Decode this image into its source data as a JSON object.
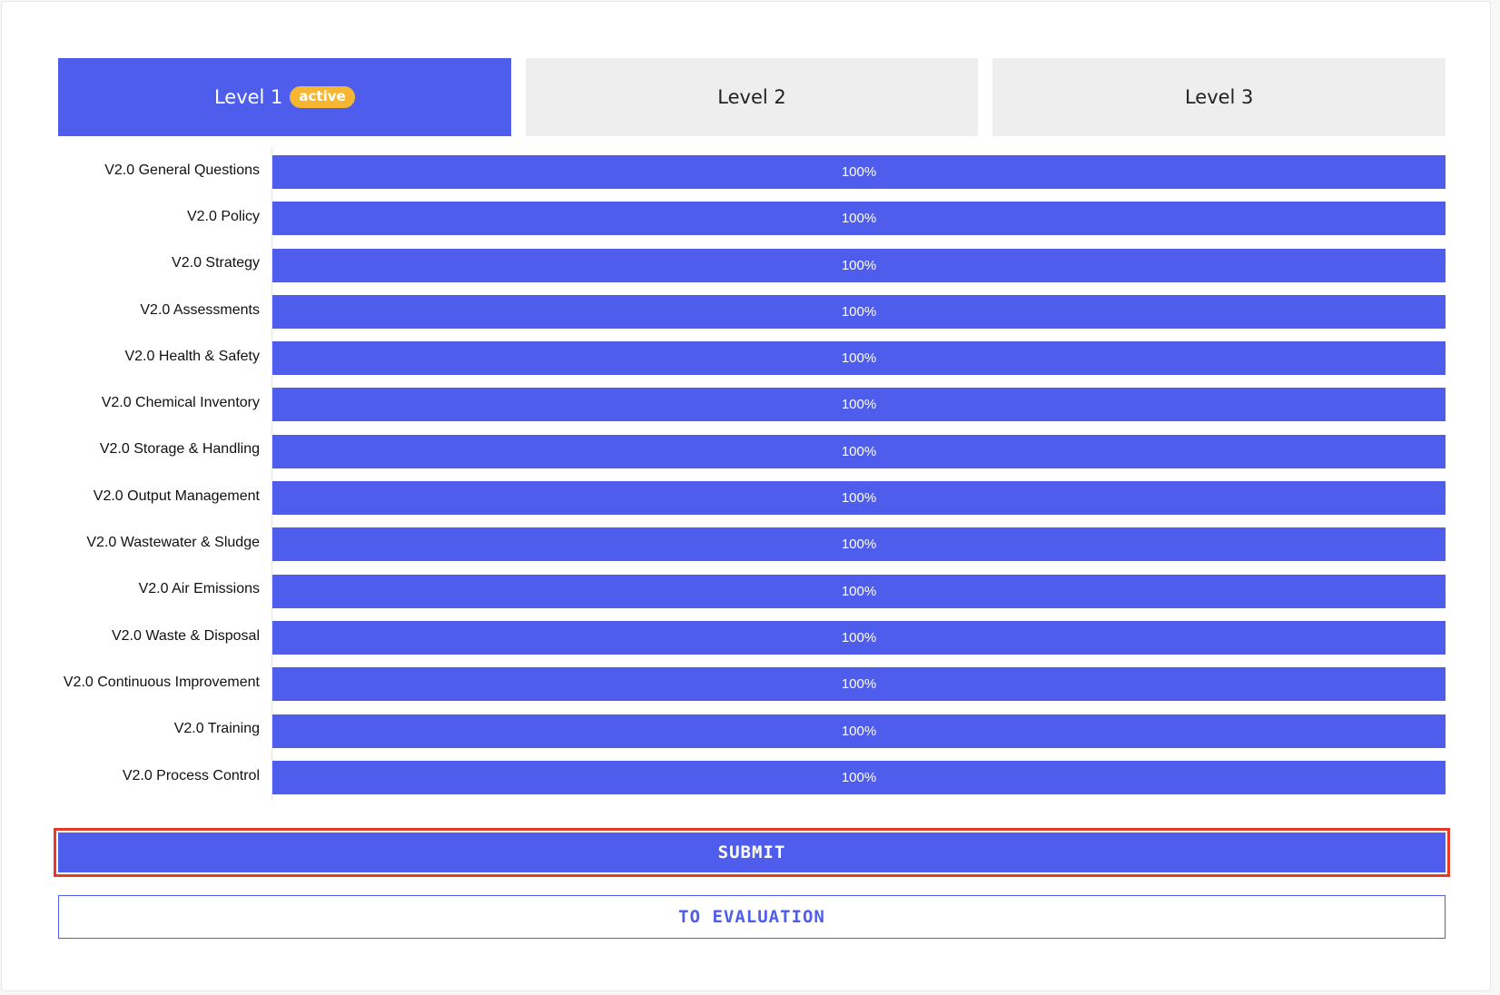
{
  "tabs": [
    {
      "label": "Level 1",
      "badge": "active",
      "active": true
    },
    {
      "label": "Level 2",
      "active": false
    },
    {
      "label": "Level 3",
      "active": false
    }
  ],
  "rows": [
    {
      "label": "V2.0 General Questions",
      "progress": 100,
      "progress_text": "100%"
    },
    {
      "label": "V2.0 Policy",
      "progress": 100,
      "progress_text": "100%"
    },
    {
      "label": "V2.0 Strategy",
      "progress": 100,
      "progress_text": "100%"
    },
    {
      "label": "V2.0 Assessments",
      "progress": 100,
      "progress_text": "100%"
    },
    {
      "label": "V2.0 Health & Safety",
      "progress": 100,
      "progress_text": "100%"
    },
    {
      "label": "V2.0 Chemical Inventory",
      "progress": 100,
      "progress_text": "100%"
    },
    {
      "label": "V2.0 Storage & Handling",
      "progress": 100,
      "progress_text": "100%"
    },
    {
      "label": "V2.0 Output Management",
      "progress": 100,
      "progress_text": "100%"
    },
    {
      "label": "V2.0 Wastewater & Sludge",
      "progress": 100,
      "progress_text": "100%"
    },
    {
      "label": "V2.0 Air Emissions",
      "progress": 100,
      "progress_text": "100%"
    },
    {
      "label": "V2.0 Waste & Disposal",
      "progress": 100,
      "progress_text": "100%"
    },
    {
      "label": "V2.0 Continuous Improvement",
      "progress": 100,
      "progress_text": "100%"
    },
    {
      "label": "V2.0 Training",
      "progress": 100,
      "progress_text": "100%"
    },
    {
      "label": "V2.0 Process Control",
      "progress": 100,
      "progress_text": "100%"
    }
  ],
  "actions": {
    "submit_label": "SUBMIT",
    "evaluation_label": "TO EVALUATION"
  },
  "colors": {
    "accent": "#4f5ded",
    "badge": "#f5b731",
    "highlight": "#e8382a",
    "tab_inactive": "#eeeeee"
  }
}
